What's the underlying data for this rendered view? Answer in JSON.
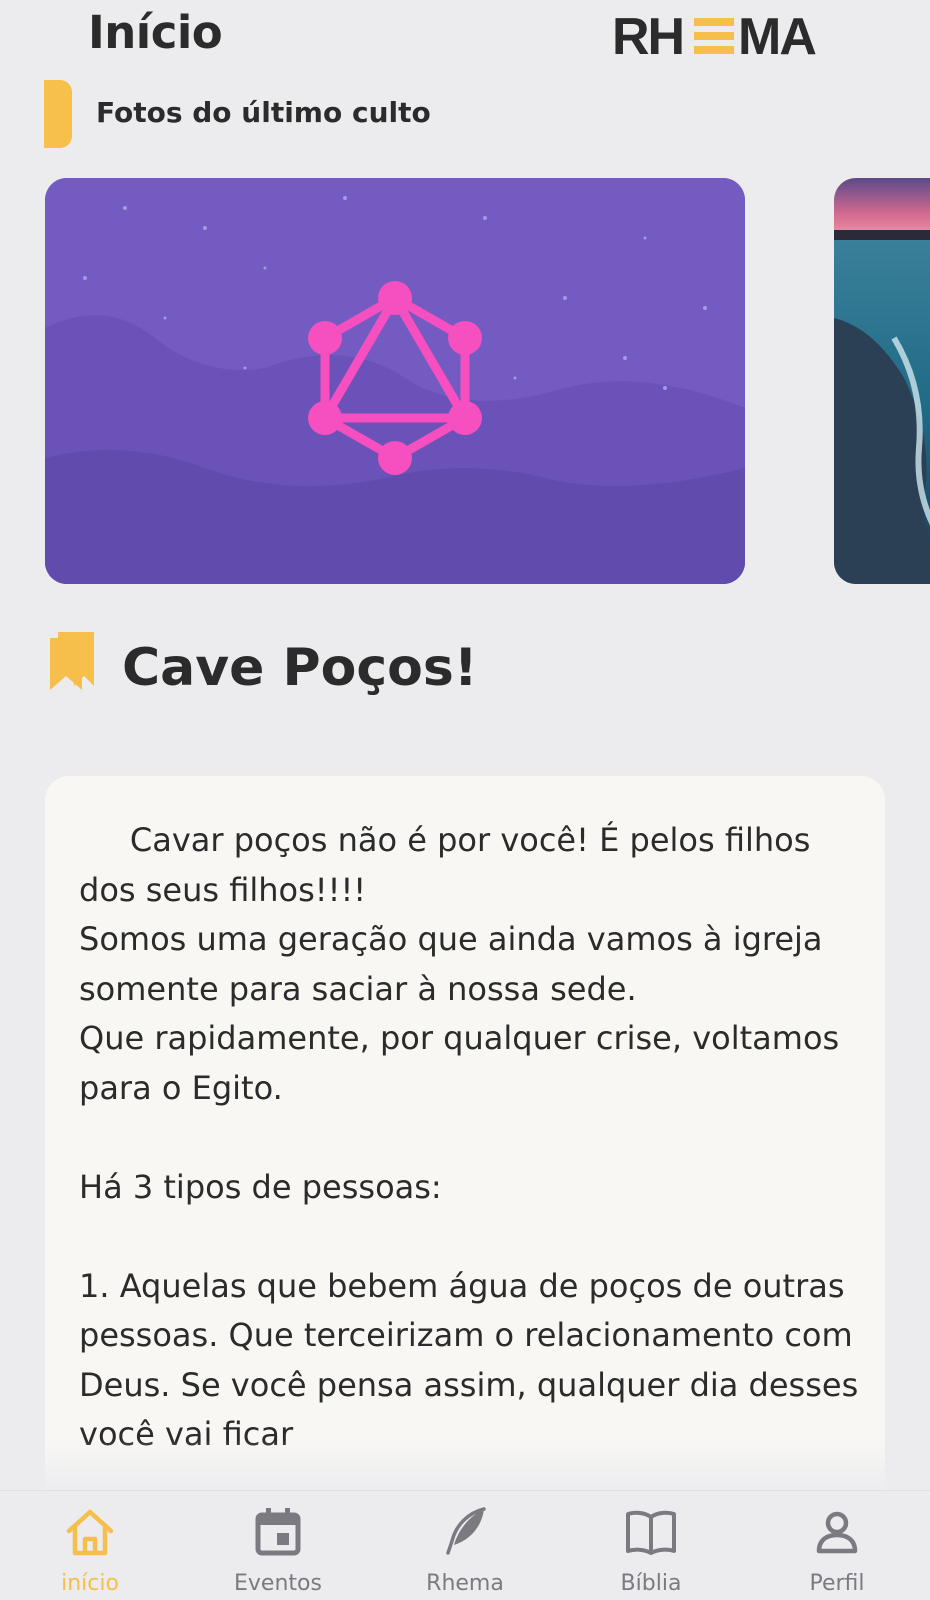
{
  "header": {
    "title": "Início",
    "logo_text": "RHEMA"
  },
  "section": {
    "label": "Fotos do último culto"
  },
  "carousel": {
    "photos": [
      "graphql-logo-photo",
      "beach-sunset-photo"
    ]
  },
  "devotional": {
    "title": "Cave Poços!",
    "body": "     Cavar poços não é por você! É pelos filhos dos seus filhos!!!!\nSomos uma geração que ainda vamos à igreja somente para saciar à nossa sede.\nQue rapidamente, por qualquer crise, voltamos\npara o Egito.\n\nHá 3 tipos de pessoas:\n\n1. Aquelas que bebem água de poços de outras pessoas. Que terceirizam o relacionamento com Deus. Se você pensa assim, qualquer dia desses você vai ficar"
  },
  "tabbar": {
    "tabs": [
      {
        "label": "início",
        "icon": "home-icon",
        "active": true
      },
      {
        "label": "Eventos",
        "icon": "calendar-icon",
        "active": false
      },
      {
        "label": "Rhema",
        "icon": "feather-icon",
        "active": false
      },
      {
        "label": "Bíblia",
        "icon": "book-icon",
        "active": false
      },
      {
        "label": "Perfil",
        "icon": "person-icon",
        "active": false
      }
    ]
  },
  "colors": {
    "accent": "#f6be4a",
    "card_purple": "#735bc2",
    "graphql_pink": "#f64fc0",
    "background": "#ececef"
  }
}
